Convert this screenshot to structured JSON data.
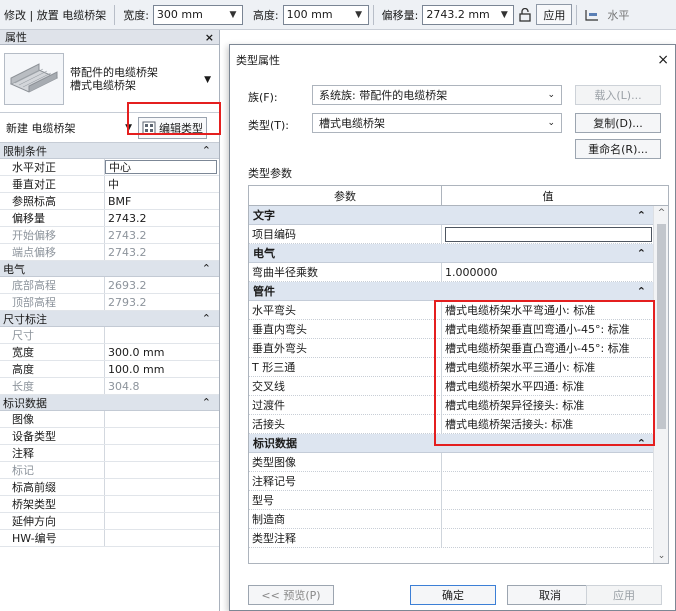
{
  "option_bar": {
    "breadcrumb": "修改 | 放置 电缆桥架",
    "width_label": "宽度:",
    "width_value": "300 mm",
    "height_label": "高度:",
    "height_value": "100 mm",
    "offset_label": "偏移量:",
    "offset_value": "2743.2 mm",
    "apply_label": "应用",
    "horizontal_label": "水平"
  },
  "properties": {
    "title": "属性",
    "close": "×",
    "type_line1": "带配件的电缆桥架",
    "type_line2": "槽式电缆桥架",
    "instance_selector": "新建 电缆桥架",
    "edit_type_label": "编辑类型",
    "groups": [
      {
        "name": "限制条件",
        "rows": [
          {
            "name": "水平对正",
            "value": "中心",
            "boxed": true
          },
          {
            "name": "垂直对正",
            "value": "中"
          },
          {
            "name": "参照标高",
            "value": "BMF"
          },
          {
            "name": "偏移量",
            "value": "2743.2"
          },
          {
            "name": "开始偏移",
            "value": "2743.2",
            "disabled": true
          },
          {
            "name": "端点偏移",
            "value": "2743.2",
            "disabled": true
          }
        ]
      },
      {
        "name": "电气",
        "rows": [
          {
            "name": "底部高程",
            "value": "2693.2",
            "disabled": true
          },
          {
            "name": "顶部高程",
            "value": "2793.2",
            "disabled": true
          }
        ]
      },
      {
        "name": "尺寸标注",
        "rows": [
          {
            "name": "尺寸",
            "value": "",
            "disabled": true
          },
          {
            "name": "宽度",
            "value": "300.0 mm"
          },
          {
            "name": "高度",
            "value": "100.0 mm"
          },
          {
            "name": "长度",
            "value": "304.8",
            "disabled": true
          }
        ]
      },
      {
        "name": "标识数据",
        "rows": [
          {
            "name": "图像",
            "value": ""
          },
          {
            "name": "设备类型",
            "value": ""
          },
          {
            "name": "注释",
            "value": ""
          },
          {
            "name": "标记",
            "value": "",
            "disabled": true
          },
          {
            "name": "标高前缀",
            "value": ""
          },
          {
            "name": "桥架类型",
            "value": ""
          },
          {
            "name": "延伸方向",
            "value": ""
          },
          {
            "name": "HW-编号",
            "value": ""
          }
        ]
      }
    ]
  },
  "dialog": {
    "title": "类型属性",
    "close": "×",
    "family_label": "族(F):",
    "family_value": "系统族: 带配件的电缆桥架",
    "type_label": "类型(T):",
    "type_value": "槽式电缆桥架",
    "load_button": "载入(L)...",
    "duplicate_button": "复制(D)...",
    "rename_button": "重命名(R)...",
    "params_heading": "类型参数",
    "col_param": "参数",
    "col_value": "值",
    "groups": [
      {
        "name": "文字",
        "rows": [
          {
            "name": "项目编码",
            "value": "",
            "input": true
          }
        ]
      },
      {
        "name": "电气",
        "rows": [
          {
            "name": "弯曲半径乘数",
            "value": "1.000000"
          }
        ]
      },
      {
        "name": "管件",
        "rows": [
          {
            "name": "水平弯头",
            "value": "槽式电缆桥架水平弯通小: 标准"
          },
          {
            "name": "垂直内弯头",
            "value": "槽式电缆桥架垂直凹弯通小-45°: 标准"
          },
          {
            "name": "垂直外弯头",
            "value": "槽式电缆桥架垂直凸弯通小-45°: 标准"
          },
          {
            "name": "T 形三通",
            "value": "槽式电缆桥架水平三通小: 标准"
          },
          {
            "name": "交叉线",
            "value": "槽式电缆桥架水平四通: 标准"
          },
          {
            "name": "过渡件",
            "value": "槽式电缆桥架异径接头: 标准"
          },
          {
            "name": "活接头",
            "value": "槽式电缆桥架活接头: 标准"
          }
        ]
      },
      {
        "name": "标识数据",
        "rows": [
          {
            "name": "类型图像",
            "value": ""
          },
          {
            "name": "注释记号",
            "value": ""
          },
          {
            "name": "型号",
            "value": ""
          },
          {
            "name": "制造商",
            "value": ""
          },
          {
            "name": "类型注释",
            "value": ""
          }
        ]
      }
    ],
    "preview_button": "<< 预览(P)",
    "ok_button": "确定",
    "cancel_button": "取消",
    "apply_button": "应用"
  },
  "colors": {
    "highlight": "#e41f1f",
    "group_header": "#dde5f0"
  }
}
